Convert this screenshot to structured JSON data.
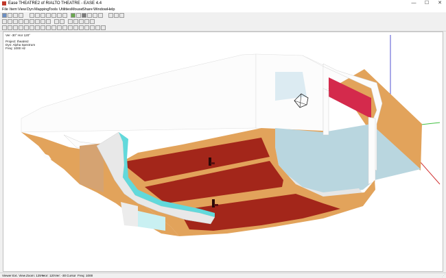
{
  "window": {
    "title": "Ease THEATRE2 of RIALTO THEATRE - EASE 4.4",
    "minimize_glyph": "—",
    "maximize_glyph": "☐",
    "close_glyph": "✕",
    "app_icon": "ease-app-icon"
  },
  "menu": [
    "File",
    "Item",
    "View",
    "Dyn",
    "Mapping",
    "Tools",
    "Utilities",
    "Mouse",
    "Share",
    "Window",
    "Help"
  ],
  "viewport": {
    "view_angles": "Ver -30°  Hor 120°",
    "project_line": "Project: theatre2",
    "dyn_line": "Dyn: Alpha Spectrum",
    "freq_line": "Freq: 1000 Hz"
  },
  "scene_colors": {
    "wall_white": "#fcfcfc",
    "wood": "#e2a35b",
    "seating": "#a3261a",
    "stage_blue": "#b9d6df",
    "railing_cyan": "#62d9db",
    "proscenium_red": "#d42a4c",
    "axis_x": "#3fbf3f",
    "axis_y": "#5050d0",
    "axis_z": "#d03030"
  },
  "status": [
    "Viewer",
    "Ext. View",
    "Zoom: 125%",
    "Hor: 120",
    "Ver: -30",
    "Cursor",
    "Freq: 1000"
  ]
}
